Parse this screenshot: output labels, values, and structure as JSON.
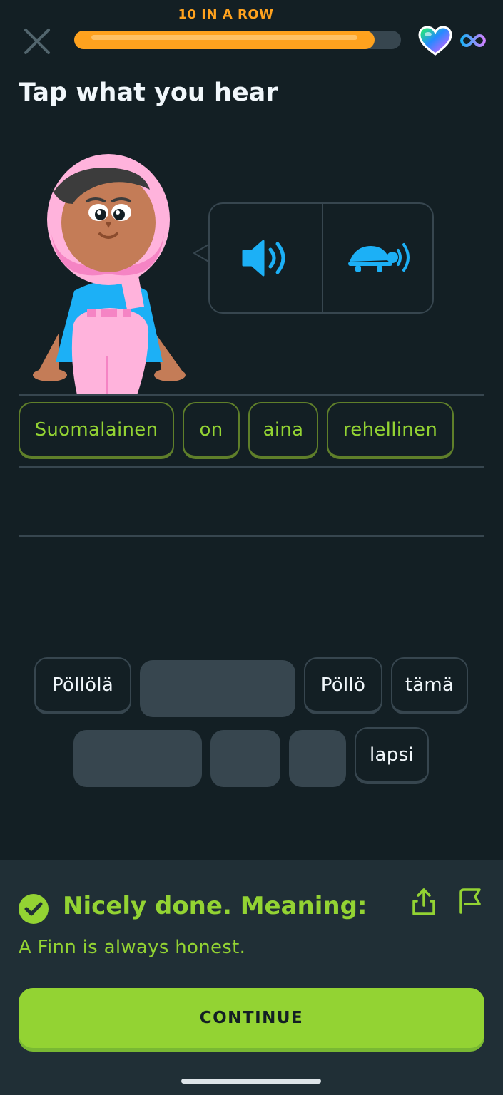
{
  "header": {
    "streak_label": "10 IN A ROW",
    "progress_fraction": 0.92,
    "hearts": "∞"
  },
  "prompt": {
    "title": "Tap what you hear"
  },
  "audio": {
    "normal_icon": "speaker-icon",
    "slow_icon": "turtle-speaker-icon"
  },
  "answer": {
    "words": [
      "Suomalainen",
      "on",
      "aina",
      "rehellinen"
    ]
  },
  "word_bank": {
    "row1": [
      "Pöllölä",
      "",
      "Pöllö",
      "tämä"
    ],
    "row2": [
      "",
      "",
      "",
      "lapsi"
    ]
  },
  "feedback": {
    "heading": "Nicely done. Meaning:",
    "translation": "A Finn is always honest.",
    "continue_label": "CONTINUE"
  },
  "colors": {
    "background": "#131f24",
    "panel": "#202f36",
    "accent_green": "#93d333",
    "streak_orange": "#ffa21e",
    "audio_blue": "#1cb0f6",
    "border": "#37464f"
  }
}
